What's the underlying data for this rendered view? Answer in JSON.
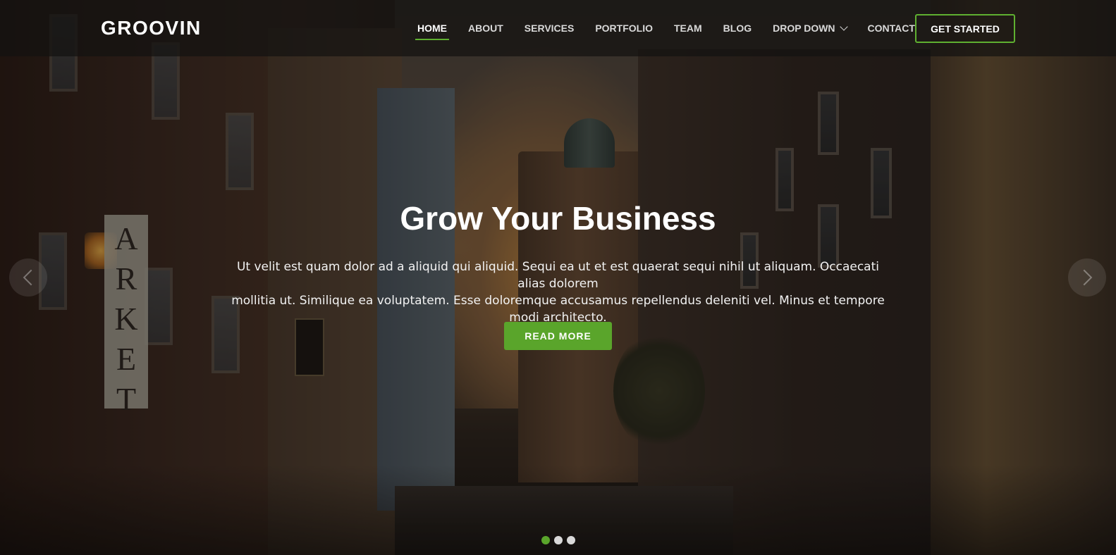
{
  "brand": {
    "logo": "GROOVIN"
  },
  "nav": {
    "items": [
      {
        "label": "HOME",
        "active": true
      },
      {
        "label": "ABOUT"
      },
      {
        "label": "SERVICES"
      },
      {
        "label": "PORTFOLIO"
      },
      {
        "label": "TEAM"
      },
      {
        "label": "BLOG"
      },
      {
        "label": "DROP DOWN",
        "has_dropdown": true
      },
      {
        "label": "CONTACT"
      }
    ],
    "cta_label": "GET STARTED"
  },
  "hero": {
    "title": "Grow Your Business",
    "text_line1": "Ut velit est quam dolor ad a aliquid qui aliquid. Sequi ea ut et est quaerat sequi nihil ut aliquam. Occaecati alias dolorem",
    "text_line2": "mollitia ut. Similique ea voluptatem. Esse doloremque accusamus repellendus deleniti vel. Minus et tempore modi architecto.",
    "button_label": "READ MORE",
    "background_signs": {
      "arket": "ARKET"
    }
  },
  "carousel": {
    "slide_count": 3,
    "active_index": 0
  },
  "colors": {
    "accent": "#5aa52b",
    "header_bg": "rgba(20,18,16,0.72)"
  }
}
